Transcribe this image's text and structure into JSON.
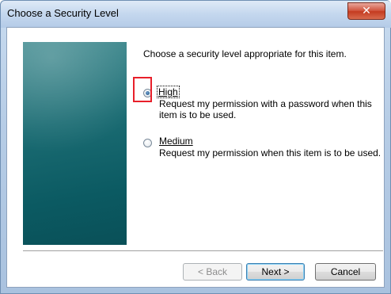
{
  "window": {
    "title": "Choose a Security Level",
    "close_glyph": "✕"
  },
  "content": {
    "instruction": "Choose a security level appropriate for this item.",
    "options": [
      {
        "label": "High",
        "description_line1": "Request my permission with a password when this",
        "description_line2": "item is to be used.",
        "selected": true
      },
      {
        "label": "Medium",
        "description_line1": "Request my permission when this item is to be used.",
        "selected": false
      }
    ]
  },
  "buttons": {
    "back": "< Back",
    "next": "Next >",
    "cancel": "Cancel"
  },
  "colors": {
    "highlight": "#e8202a",
    "side_panel": "#0b5a62"
  }
}
